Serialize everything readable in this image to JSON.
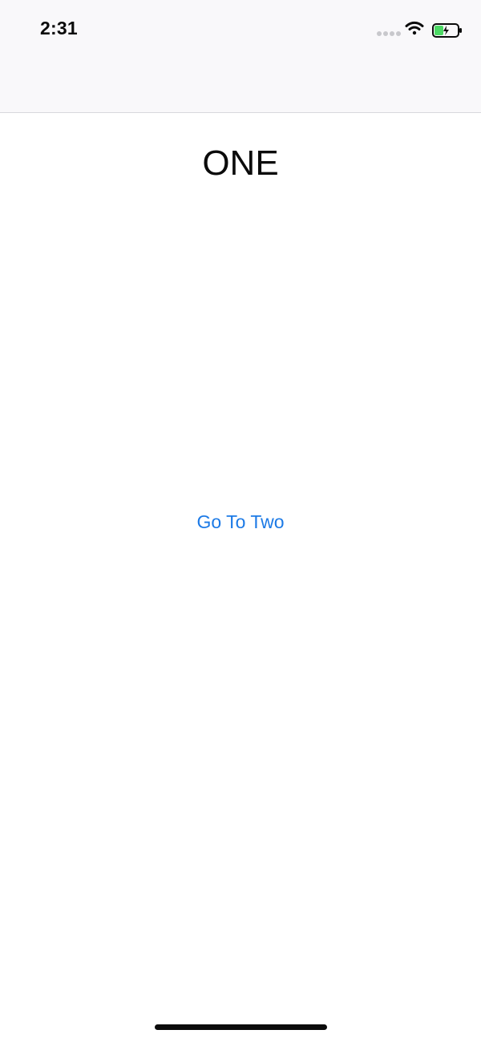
{
  "status_bar": {
    "time": "2:31",
    "signal_icon": "cellular-signal-icon",
    "wifi_icon": "wifi-icon",
    "battery_icon": "battery-charging-icon",
    "battery_level": 0.4,
    "colors": {
      "battery_fill": "#4cd964",
      "text": "#0b0b0b"
    }
  },
  "nav_bar": {
    "title": ""
  },
  "main": {
    "title": "ONE",
    "go_button_label": "Go To Two"
  },
  "colors": {
    "accent": "#1c7ae6",
    "top_background": "#f9f8fa",
    "background": "#ffffff"
  }
}
